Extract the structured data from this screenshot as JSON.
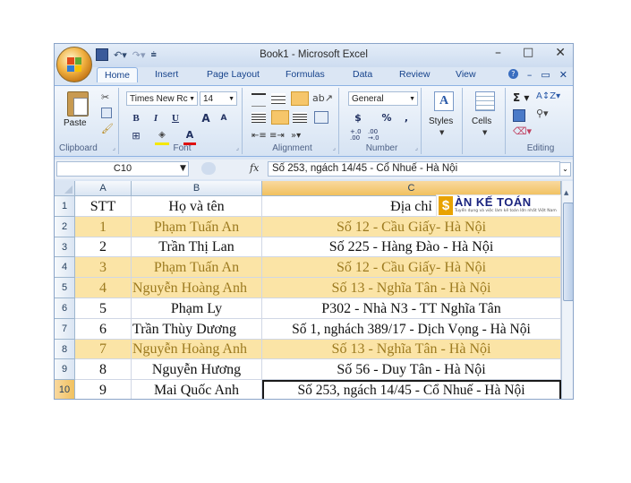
{
  "window": {
    "title": "Book1 - Microsoft Excel",
    "controls": {
      "minimize": "–",
      "maximize": "□",
      "close": "✕"
    }
  },
  "tabs": [
    "Home",
    "Insert",
    "Page Layout",
    "Formulas",
    "Data",
    "Review",
    "View"
  ],
  "ribbon": {
    "clipboard": {
      "label": "Clipboard",
      "paste": "Paste"
    },
    "font": {
      "label": "Font",
      "family": "Times New Rc",
      "size": "14",
      "bold": "B",
      "italic": "I",
      "underline": "U",
      "grow": "A",
      "shrink": "A"
    },
    "alignment": {
      "label": "Alignment"
    },
    "number": {
      "label": "Number",
      "format": "General",
      "currency": "$",
      "percent": "%",
      "comma": ",",
      "inc_decimal": "+.0\n.00",
      "dec_decimal": ".00\n→.0"
    },
    "styles": {
      "label": "Styles"
    },
    "cells": {
      "label": "Cells"
    },
    "editing": {
      "label": "Editing"
    }
  },
  "formula_bar": {
    "name_box": "C10",
    "fx": "fx",
    "content": "Số 253, ngách 14/45 - Cổ Nhuế - Hà Nội"
  },
  "grid": {
    "columns": [
      "A",
      "B",
      "C"
    ],
    "selected_column": "C",
    "selected_row": "10",
    "rows": [
      {
        "num": "1",
        "a": "STT",
        "b": "Họ và tên",
        "c": "Địa chỉ",
        "highlight": false
      },
      {
        "num": "2",
        "a": "1",
        "b": "Phạm Tuấn An",
        "c": "Số 12 - Cầu Giấy- Hà Nội",
        "highlight": true
      },
      {
        "num": "3",
        "a": "2",
        "b": "Trần Thị Lan",
        "c": "Số 225 - Hàng Đào - Hà Nội",
        "highlight": false
      },
      {
        "num": "4",
        "a": "3",
        "b": "Phạm Tuấn An",
        "c": "Số 12 - Cầu Giấy- Hà Nội",
        "highlight": true
      },
      {
        "num": "5",
        "a": "4",
        "b": "Nguyễn Hoàng Anh",
        "c": "Số 13 - Nghĩa Tân - Hà Nội",
        "highlight": true
      },
      {
        "num": "6",
        "a": "5",
        "b": "Phạm Ly",
        "c": "P302 - Nhà N3 - TT Nghĩa Tân",
        "highlight": false
      },
      {
        "num": "7",
        "a": "6",
        "b": "Trần Thùy Dương",
        "c": "Số 1, nghách 389/17 - Dịch Vọng - Hà Nội",
        "highlight": false
      },
      {
        "num": "8",
        "a": "7",
        "b": "Nguyễn Hoàng Anh",
        "c": "Số 13 - Nghĩa Tân - Hà Nội",
        "highlight": true
      },
      {
        "num": "9",
        "a": "8",
        "b": "Nguyễn Hương",
        "c": "Số 56 - Duy Tân - Hà Nội",
        "highlight": false
      },
      {
        "num": "10",
        "a": "9",
        "b": "Mai Quốc Anh",
        "c": "Số 253, ngách 14/45 - Cổ Nhuế - Hà Nội",
        "highlight": false
      }
    ]
  },
  "watermark": {
    "logo_letter": "$",
    "name": "ÀN KẾ TOÁN",
    "tagline": "Tuyển dụng và việc làm kế toán lớn nhất Việt Nam"
  },
  "colors": {
    "highlight_fill": "#fbe4a6",
    "highlight_text": "#9c7a1f",
    "ribbon_blue": "#15428b",
    "selected_header": "#f1c15f"
  }
}
